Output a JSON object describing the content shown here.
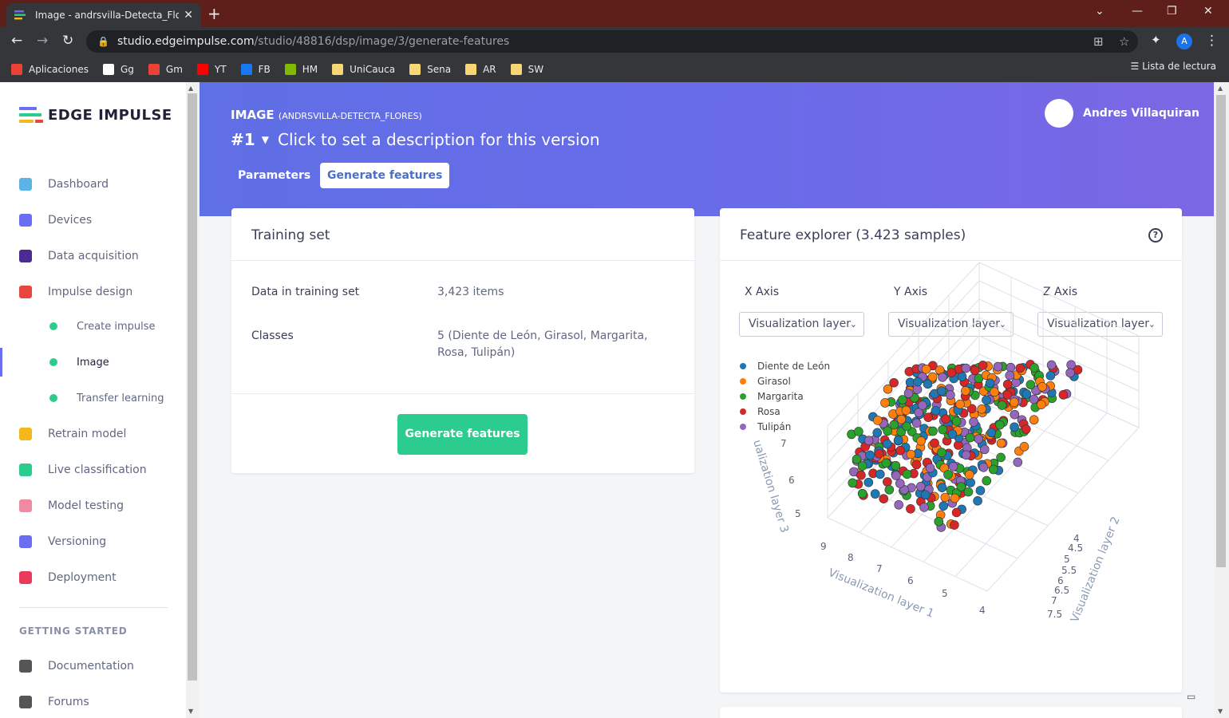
{
  "browser": {
    "tab_title": "Image - andrsvilla-Detecta_Flores",
    "close_glyph": "✕",
    "new_tab_glyph": "+",
    "url_host": "studio.edgeimpulse.com",
    "url_path": "/studio/48816/dsp/image/3/generate-features",
    "profile_initial": "A",
    "bookmarks": [
      {
        "label": "Aplicaciones",
        "icon": "apps-grid-icon",
        "color": "#ea4335"
      },
      {
        "label": "Gg",
        "icon": "google-icon",
        "color": "#ffffff"
      },
      {
        "label": "Gm",
        "icon": "gmail-icon",
        "color": "#ea4335"
      },
      {
        "label": "YT",
        "icon": "youtube-icon",
        "color": "#ff0000"
      },
      {
        "label": "FB",
        "icon": "facebook-icon",
        "color": "#1877f2"
      },
      {
        "label": "HM",
        "icon": "microsoft-icon",
        "color": "#7fba00"
      },
      {
        "label": "UniCauca",
        "icon": "folder-icon",
        "color": "#f7d774"
      },
      {
        "label": "Sena",
        "icon": "folder-icon",
        "color": "#f7d774"
      },
      {
        "label": "AR",
        "icon": "folder-icon",
        "color": "#f7d774"
      },
      {
        "label": "SW",
        "icon": "folder-icon",
        "color": "#f7d774"
      }
    ],
    "reading_list": "Lista de lectura"
  },
  "sidebar": {
    "logo_text": "EDGE IMPULSE",
    "items": [
      {
        "label": "Dashboard",
        "icon": "monitor-icon",
        "color": "#5bb4e5"
      },
      {
        "label": "Devices",
        "icon": "chip-icon",
        "color": "#6b6ef2"
      },
      {
        "label": "Data acquisition",
        "icon": "database-icon",
        "color": "#4a2b8f"
      },
      {
        "label": "Impulse design",
        "icon": "pulse-icon",
        "color": "#e8453c"
      }
    ],
    "sub_items": [
      {
        "label": "Create impulse"
      },
      {
        "label": "Image"
      },
      {
        "label": "Transfer learning"
      }
    ],
    "items2": [
      {
        "label": "Retrain model",
        "icon": "shuffle-icon",
        "color": "#f2b81c"
      },
      {
        "label": "Live classification",
        "icon": "signal-icon",
        "color": "#2ccb8e"
      },
      {
        "label": "Model testing",
        "icon": "clipboard-check-icon",
        "color": "#f08aa0"
      },
      {
        "label": "Versioning",
        "icon": "branch-icon",
        "color": "#6b6ef2"
      },
      {
        "label": "Deployment",
        "icon": "cube-icon",
        "color": "#e83a5a"
      }
    ],
    "section_label": "GETTING STARTED",
    "items3": [
      {
        "label": "Documentation",
        "icon": "rocket-icon",
        "color": "#555"
      },
      {
        "label": "Forums",
        "icon": "chat-icon",
        "color": "#555"
      }
    ]
  },
  "header": {
    "project_prefix": "IMAGE",
    "project_name": "(ANDRSVILLA-DETECTA_FLORES)",
    "version": "#1",
    "version_description": "Click to set a description for this version",
    "tabs": [
      {
        "label": "Parameters"
      },
      {
        "label": "Generate features"
      }
    ],
    "user_name": "Andres Villaquiran"
  },
  "training": {
    "title": "Training set",
    "rows": [
      {
        "key": "Data in training set",
        "value": "3,423 items"
      },
      {
        "key": "Classes",
        "value": "5 (Diente de León, Girasol, Margarita, Rosa, Tulipán)"
      }
    ],
    "button": "Generate features"
  },
  "explorer": {
    "title": "Feature explorer (3.423 samples)",
    "help_glyph": "?",
    "axes": [
      {
        "label": "X Axis",
        "selected": "Visualization layer"
      },
      {
        "label": "Y Axis",
        "selected": "Visualization layer"
      },
      {
        "label": "Z Axis",
        "selected": "Visualization layer"
      }
    ]
  },
  "chart_data": {
    "type": "scatter",
    "dimensions": 3,
    "series": [
      {
        "name": "Diente de León",
        "color": "#1f77b4"
      },
      {
        "name": "Girasol",
        "color": "#ff7f0e"
      },
      {
        "name": "Margarita",
        "color": "#2ca02c"
      },
      {
        "name": "Rosa",
        "color": "#d62728"
      },
      {
        "name": "Tulipán",
        "color": "#9467bd"
      }
    ],
    "xlabel": "Visualization layer 1",
    "ylabel": "Visualization layer 2",
    "zlabel": "ualization layer 3",
    "x_ticks": [
      "9",
      "8",
      "7",
      "6",
      "5",
      "4"
    ],
    "y_ticks": [
      "4",
      "4.5",
      "5",
      "5.5",
      "6",
      "6.5",
      "7",
      "7.5"
    ],
    "z_ticks": [
      "7",
      "6",
      "5"
    ],
    "xlim": [
      4,
      9
    ],
    "ylim": [
      4,
      7.5
    ],
    "zlim": [
      5,
      7
    ]
  }
}
